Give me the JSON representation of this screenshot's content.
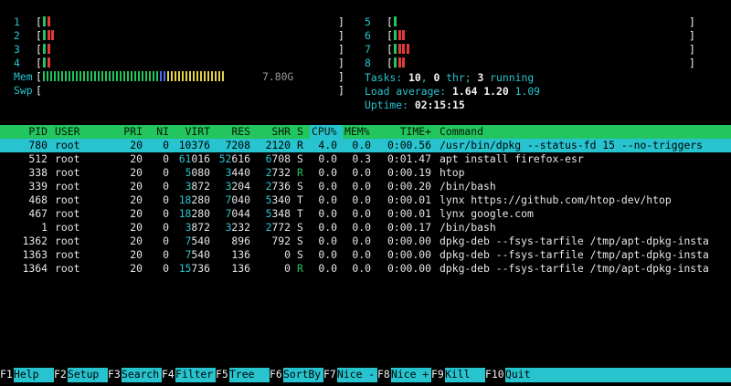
{
  "cpus": [
    {
      "id": "1",
      "bars": [
        "g",
        "r"
      ]
    },
    {
      "id": "2",
      "bars": [
        "g",
        "r",
        "r"
      ]
    },
    {
      "id": "3",
      "bars": [
        "g",
        "r"
      ]
    },
    {
      "id": "4",
      "bars": [
        "g",
        "r"
      ]
    },
    {
      "id": "5",
      "bars": [
        "g"
      ]
    },
    {
      "id": "6",
      "bars": [
        "g",
        "r",
        "r"
      ]
    },
    {
      "id": "7",
      "bars": [
        "g",
        "r",
        "r",
        "r"
      ]
    },
    {
      "id": "8",
      "bars": [
        "g",
        "r",
        "r"
      ]
    }
  ],
  "mem": {
    "label": "Mem",
    "value": "7.80G"
  },
  "swp": {
    "label": "Swp"
  },
  "tasks": {
    "prefix": "Tasks: ",
    "count": "10",
    "sep1": ", ",
    "thr": "0",
    "thr_label": " thr; ",
    "running": "3",
    "running_label": " running"
  },
  "load": {
    "prefix": "Load average: ",
    "v1": "1.64",
    "v2": "1.20",
    "v3": "1.09"
  },
  "uptime": {
    "prefix": "Uptime: ",
    "value": "02:15:15"
  },
  "columns": {
    "pid": "PID",
    "user": "USER",
    "pri": "PRI",
    "ni": "NI",
    "virt": "VIRT",
    "res": "RES",
    "shr": "SHR",
    "s": "S",
    "cpu": "CPU%",
    "mem": "MEM%",
    "time": "TIME+",
    "cmd": "Command"
  },
  "processes": [
    {
      "pid": "780",
      "user": "root",
      "pri": "20",
      "ni": "0",
      "virt": "10376",
      "res": "7208",
      "shr": "2120",
      "s": "R",
      "cpu": "4.0",
      "mem": "0.0",
      "time": "0:00.56",
      "cmd": "/usr/bin/dpkg --status-fd 15 --no-triggers"
    },
    {
      "pid": "512",
      "user": "root",
      "pri": "20",
      "ni": "0",
      "virt": "61016",
      "res": "52616",
      "shr": "6708",
      "s": "S",
      "cpu": "0.0",
      "mem": "0.3",
      "time": "0:01.47",
      "cmd": "apt install firefox-esr"
    },
    {
      "pid": "338",
      "user": "root",
      "pri": "20",
      "ni": "0",
      "virt": "5080",
      "res": "3440",
      "shr": "2732",
      "s": "R",
      "cpu": "0.0",
      "mem": "0.0",
      "time": "0:00.19",
      "cmd": "htop"
    },
    {
      "pid": "339",
      "user": "root",
      "pri": "20",
      "ni": "0",
      "virt": "3872",
      "res": "3204",
      "shr": "2736",
      "s": "S",
      "cpu": "0.0",
      "mem": "0.0",
      "time": "0:00.20",
      "cmd": "/bin/bash"
    },
    {
      "pid": "468",
      "user": "root",
      "pri": "20",
      "ni": "0",
      "virt": "18280",
      "res": "7040",
      "shr": "5340",
      "s": "T",
      "cpu": "0.0",
      "mem": "0.0",
      "time": "0:00.01",
      "cmd": "lynx https://github.com/htop-dev/htop"
    },
    {
      "pid": "467",
      "user": "root",
      "pri": "20",
      "ni": "0",
      "virt": "18280",
      "res": "7044",
      "shr": "5348",
      "s": "T",
      "cpu": "0.0",
      "mem": "0.0",
      "time": "0:00.01",
      "cmd": "lynx google.com"
    },
    {
      "pid": "1",
      "user": "root",
      "pri": "20",
      "ni": "0",
      "virt": "3872",
      "res": "3232",
      "shr": "2772",
      "s": "S",
      "cpu": "0.0",
      "mem": "0.0",
      "time": "0:00.17",
      "cmd": "/bin/bash"
    },
    {
      "pid": "1362",
      "user": "root",
      "pri": "20",
      "ni": "0",
      "virt": "7540",
      "res": "896",
      "shr": "792",
      "s": "S",
      "cpu": "0.0",
      "mem": "0.0",
      "time": "0:00.00",
      "cmd": "dpkg-deb --fsys-tarfile /tmp/apt-dpkg-insta"
    },
    {
      "pid": "1363",
      "user": "root",
      "pri": "20",
      "ni": "0",
      "virt": "7540",
      "res": "136",
      "shr": "0",
      "s": "S",
      "cpu": "0.0",
      "mem": "0.0",
      "time": "0:00.00",
      "cmd": "dpkg-deb --fsys-tarfile /tmp/apt-dpkg-insta"
    },
    {
      "pid": "1364",
      "user": "root",
      "pri": "20",
      "ni": "0",
      "virt": "15736",
      "res": "136",
      "shr": "0",
      "s": "R",
      "cpu": "0.0",
      "mem": "0.0",
      "time": "0:00.00",
      "cmd": "dpkg-deb --fsys-tarfile /tmp/apt-dpkg-insta"
    }
  ],
  "fkeys": [
    {
      "num": "F1",
      "label": "Help"
    },
    {
      "num": "F2",
      "label": "Setup"
    },
    {
      "num": "F3",
      "label": "Search"
    },
    {
      "num": "F4",
      "label": "Filter"
    },
    {
      "num": "F5",
      "label": "Tree"
    },
    {
      "num": "F6",
      "label": "SortBy"
    },
    {
      "num": "F7",
      "label": "Nice -"
    },
    {
      "num": "F8",
      "label": "Nice +"
    },
    {
      "num": "F9",
      "label": "Kill"
    },
    {
      "num": "F10",
      "label": "Quit"
    }
  ],
  "colors": {
    "green": "#22c55e",
    "cyan": "#27c4cf",
    "red": "#e23a3a",
    "blue": "#4a6cf0",
    "yellow": "#e3d24a"
  }
}
